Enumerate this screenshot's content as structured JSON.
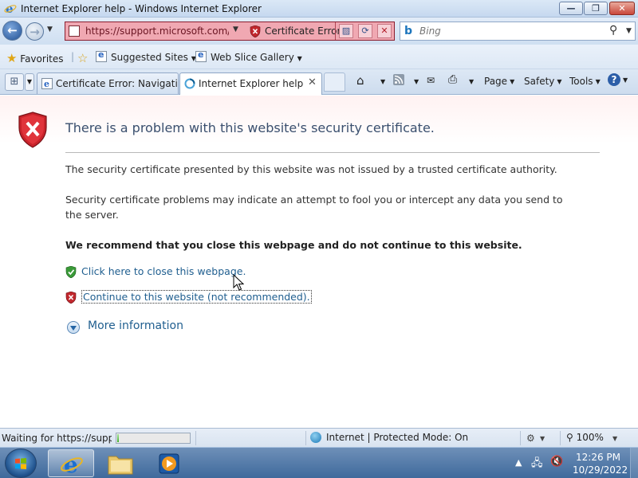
{
  "window": {
    "title": "Internet Explorer help - Windows Internet Explorer",
    "minimize_glyph": "—",
    "maximize_glyph": "❐",
    "close_glyph": "✕"
  },
  "navigation": {
    "back_glyph": "←",
    "forward_glyph": "→",
    "address_url": "https://support.microsoft.com/en",
    "certificate_label": "Certificate Error",
    "search_placeholder": "Bing",
    "search_engine_glyph": "b"
  },
  "favorites_bar": {
    "favorites_label": "Favorites",
    "items": [
      {
        "label": "Suggested Sites"
      },
      {
        "label": "Web Slice Gallery"
      }
    ]
  },
  "tabs": [
    {
      "label": "Certificate Error: Navigatio...",
      "active": false
    },
    {
      "label": "Internet Explorer help",
      "active": true,
      "close_glyph": "✕"
    }
  ],
  "command_bar": {
    "page_label": "Page",
    "safety_label": "Safety",
    "tools_label": "Tools",
    "help_glyph": "?"
  },
  "content": {
    "title": "There is a problem with this website's security certificate.",
    "paragraph_1": "The security certificate presented by this website was not issued by a trusted certificate authority.",
    "paragraph_2": "Security certificate problems may indicate an attempt to fool you or intercept any data you send to the server.",
    "recommendation": "We recommend that you close this webpage and do not continue to this website.",
    "close_link": "Click here to close this webpage.",
    "continue_link": "Continue to this website (not recommended).",
    "more_info": "More information"
  },
  "status_bar": {
    "status_text": "Waiting for https://support.microsoft.com/en",
    "progress": 0.02,
    "zone_text": "Internet | Protected Mode: On",
    "zoom": "100%"
  },
  "taskbar": {
    "time": "12:26 PM",
    "date": "10/29/2022"
  },
  "colors": {
    "address_bar_error": "#f0a8b2",
    "link": "#1f5e8f",
    "title_text": "#3a4f6e",
    "taskbar": "#4f79a8"
  }
}
